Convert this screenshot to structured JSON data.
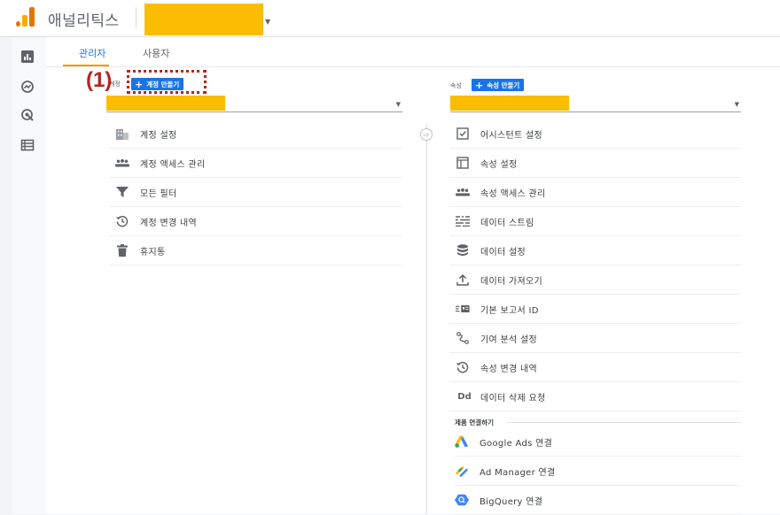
{
  "header": {
    "app_title": "애널리틱스"
  },
  "tabs": [
    {
      "label": "관리자",
      "active": true
    },
    {
      "label": "사용자",
      "active": false
    }
  ],
  "annotation": {
    "label": "(1)"
  },
  "account_column": {
    "label": "계정",
    "create_button": "계정 만들기",
    "items": [
      {
        "label": "계정 설정",
        "icon": "building-icon"
      },
      {
        "label": "계정 액세스 관리",
        "icon": "people-icon"
      },
      {
        "label": "모든 필터",
        "icon": "filter-icon"
      },
      {
        "label": "계정 변경 내역",
        "icon": "history-icon"
      },
      {
        "label": "휴지통",
        "icon": "trash-icon"
      }
    ]
  },
  "property_column": {
    "label": "속성",
    "create_button": "속성 만들기",
    "items": [
      {
        "label": "어시스턴트 설정",
        "icon": "checkbox-icon"
      },
      {
        "label": "속성 설정",
        "icon": "window-icon"
      },
      {
        "label": "속성 액세스 관리",
        "icon": "people-icon"
      },
      {
        "label": "데이터 스트림",
        "icon": "streams-icon"
      },
      {
        "label": "데이터 설정",
        "icon": "database-icon"
      },
      {
        "label": "데이터 가져오기",
        "icon": "upload-icon"
      },
      {
        "label": "기본 보고서 ID",
        "icon": "id-icon"
      },
      {
        "label": "기여 분석 설정",
        "icon": "attribution-icon"
      },
      {
        "label": "속성 변경 내역",
        "icon": "history-icon"
      },
      {
        "label": "데이터 삭제 요청",
        "icon": "dd-icon",
        "icon_text": "Dd"
      }
    ],
    "section_title": "제품 연결하기",
    "links": [
      {
        "label": "Google Ads 연결",
        "icon": "google-ads-icon"
      },
      {
        "label": "Ad Manager 연결",
        "icon": "ad-manager-icon"
      },
      {
        "label": "BigQuery 연결",
        "icon": "bigquery-icon"
      }
    ]
  },
  "colors": {
    "accent": "#1a73e8",
    "redacted": "#fbbc04",
    "annotation": "#b3261e",
    "tab_underline": "#f29900"
  }
}
